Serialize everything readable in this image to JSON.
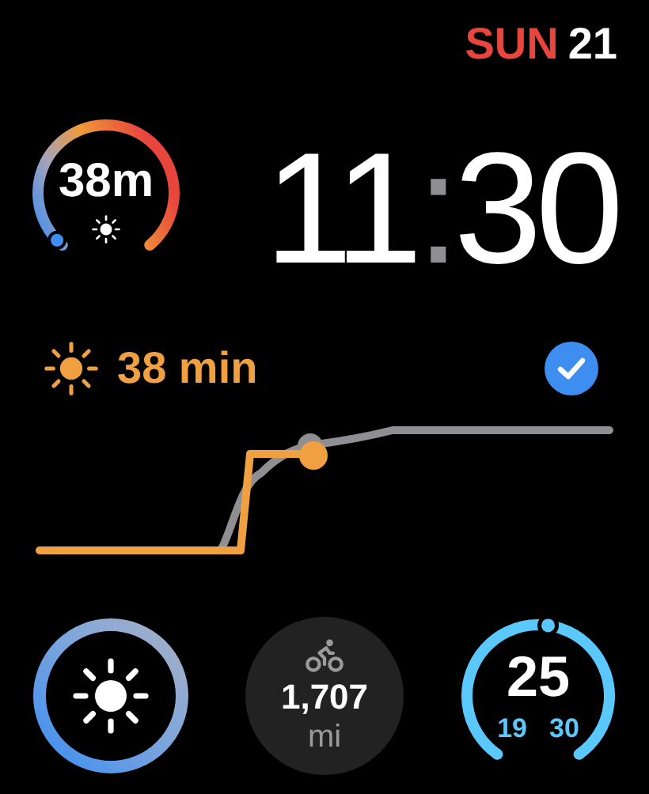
{
  "date": {
    "weekday": "SUN",
    "day": "21"
  },
  "time": {
    "hours": "11",
    "separator": ":",
    "minutes": "30"
  },
  "daylight_gauge": {
    "value": "38m"
  },
  "daylight_goal": {
    "value": "38 min",
    "completed": true
  },
  "complications": [
    {
      "kind": "uv-ring"
    },
    {
      "kind": "distance",
      "value": "1,707",
      "unit": "mi"
    },
    {
      "kind": "temperature",
      "value": "25",
      "low": "19",
      "high": "30"
    }
  ]
}
